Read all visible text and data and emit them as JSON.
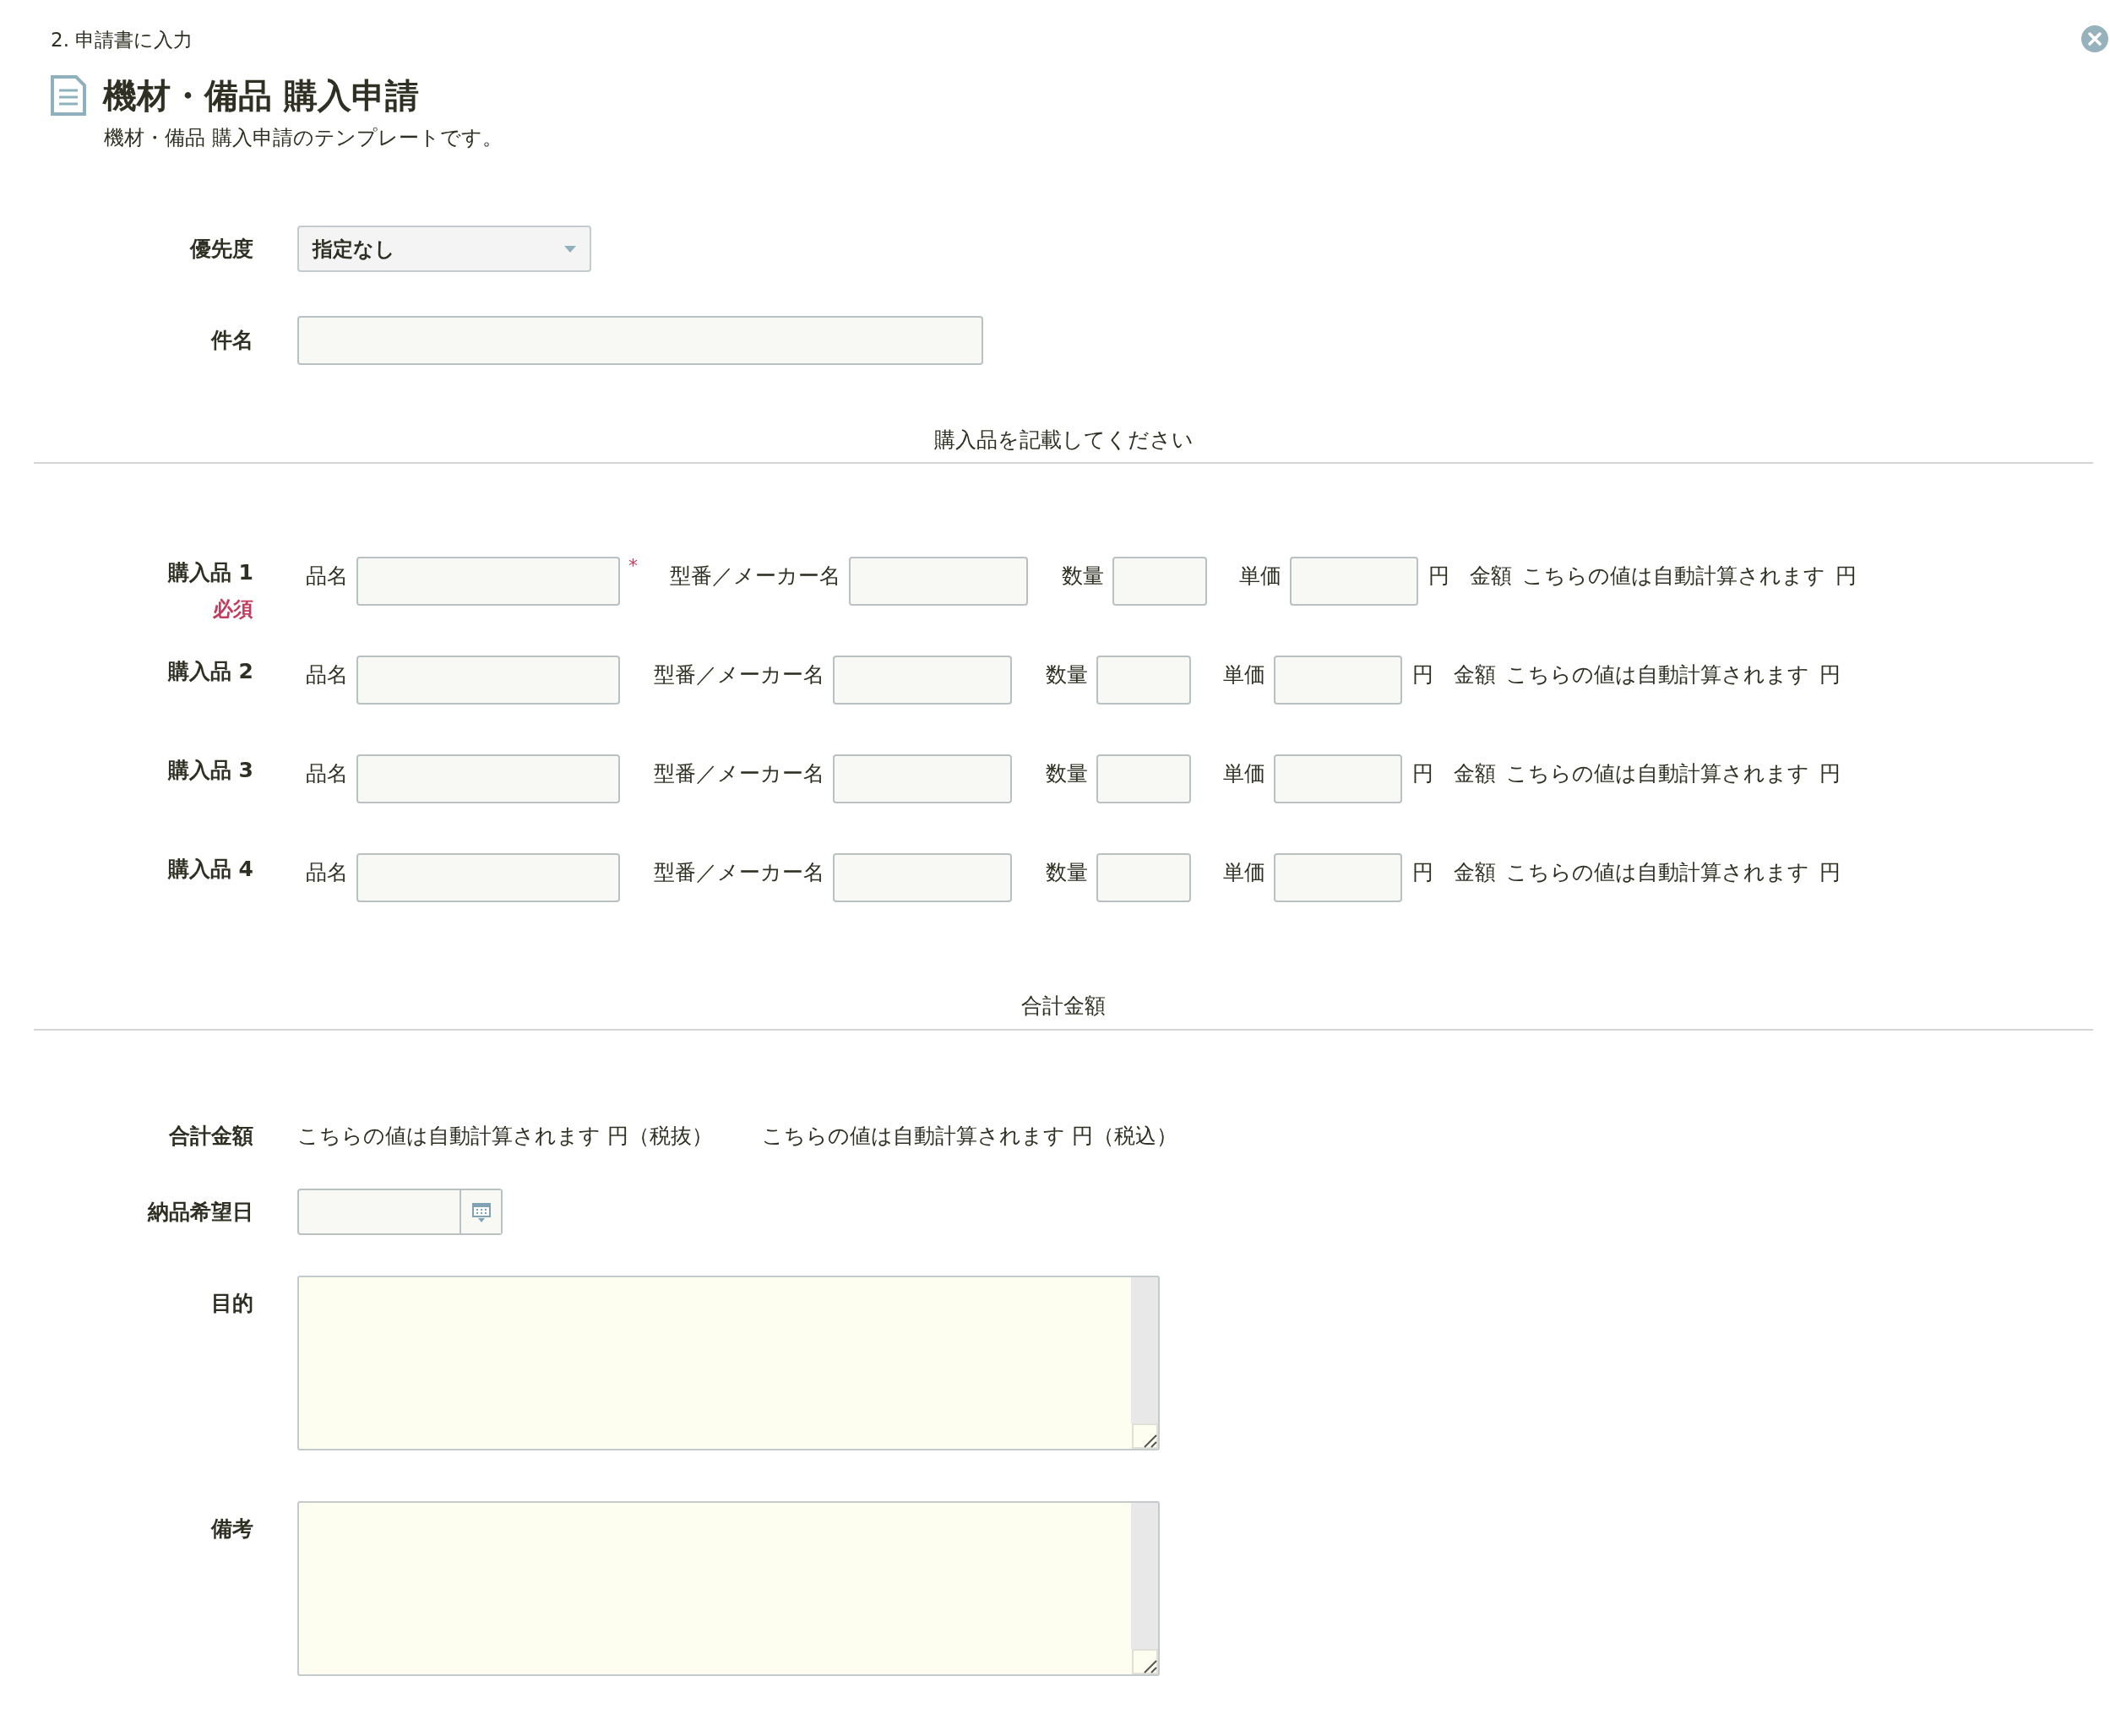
{
  "breadcrumb": "2. 申請書に入力",
  "title": "機材・備品 購入申請",
  "description": "機材・備品 購入申請のテンプレートです。",
  "fields": [
    {
      "kind": "select",
      "label": "優先度",
      "value": "指定なし"
    },
    {
      "kind": "text",
      "label": "件名"
    }
  ],
  "items_section": {
    "heading": "購入品を記載してください",
    "rows": [
      {
        "label": "購入品 1",
        "required_badge": "必須",
        "required_mark": "*",
        "name_label": "品名",
        "model_label": "型番／メーカー名",
        "quantity_label": "数量",
        "price_label": "単価",
        "price_unit": "円",
        "amount_label": "金額",
        "amount_value": "こちらの値は自動計算されます",
        "amount_unit": "円"
      },
      {
        "label": "購入品 2",
        "name_label": "品名",
        "model_label": "型番／メーカー名",
        "quantity_label": "数量",
        "price_label": "単価",
        "price_unit": "円",
        "amount_label": "金額",
        "amount_value": "こちらの値は自動計算されます",
        "amount_unit": "円"
      },
      {
        "label": "購入品 3",
        "name_label": "品名",
        "model_label": "型番／メーカー名",
        "quantity_label": "数量",
        "price_label": "単価",
        "price_unit": "円",
        "amount_label": "金額",
        "amount_value": "こちらの値は自動計算されます",
        "amount_unit": "円"
      },
      {
        "label": "購入品 4",
        "name_label": "品名",
        "model_label": "型番／メーカー名",
        "quantity_label": "数量",
        "price_label": "単価",
        "price_unit": "円",
        "amount_label": "金額",
        "amount_value": "こちらの値は自動計算されます",
        "amount_unit": "円"
      }
    ]
  },
  "total_section": {
    "heading": "合計金額",
    "fields": [
      {
        "kind": "computed",
        "label": "合計金額",
        "values": [
          "こちらの値は自動計算されます 円（税抜）",
          "こちらの値は自動計算されます 円（税込）"
        ]
      },
      {
        "kind": "date",
        "label": "納品希望日"
      },
      {
        "kind": "textarea",
        "label": "目的"
      },
      {
        "kind": "textarea",
        "label": "備考"
      }
    ]
  }
}
